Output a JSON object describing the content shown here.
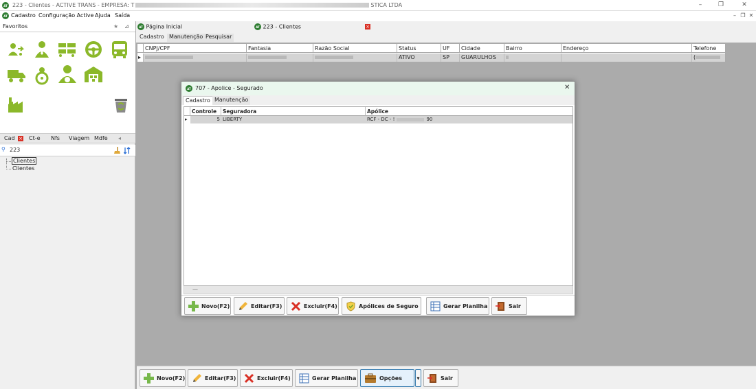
{
  "window": {
    "title_prefix": "223 - Clientes - ACTIVE TRANS - EMPRESA: T",
    "title_suffix": "STICA LTDA",
    "minimize": "–",
    "maximize": "❐",
    "close": "✕"
  },
  "logo_text": "AT",
  "menu": {
    "items": [
      "Cadastro",
      "Configuração Active",
      "Ajuda",
      "Saída"
    ],
    "mdi_min": "–",
    "mdi_restore": "❐",
    "mdi_close": "✕"
  },
  "favorites": {
    "title": "Favoritos",
    "star": "★",
    "pin": "⊿",
    "icons": [
      "user-route-icon",
      "driver-icon",
      "trucks-icon",
      "steering-wheel-icon",
      "bus-icon",
      "truck-icon",
      "driver-steering-icon",
      "driver-car-icon",
      "warehouse-icon",
      "factory-icon",
      "recycle-bin-icon"
    ]
  },
  "left_tabs": {
    "items": [
      "Cad",
      "Ct-e",
      "Nfs",
      "Viagem",
      "Mdfe"
    ],
    "close": "×",
    "scroll_left": "◂"
  },
  "search": {
    "value": "223",
    "icon": "🔍"
  },
  "tree": {
    "items": [
      "Clientes",
      "Clientes"
    ]
  },
  "doc_tabs": {
    "home": "Página Inicial",
    "clients": "223 - Clientes",
    "close": "×"
  },
  "sub_tabs": [
    "Cadastro",
    "Manutenção",
    "Pesquisar"
  ],
  "main_grid": {
    "columns": [
      "CNPJ/CPF",
      "Fantasia",
      "Razão Social",
      "Status",
      "UF",
      "Cidade",
      "Bairro",
      "Endereço",
      "Telefone"
    ],
    "row": {
      "status": "ATIVO",
      "uf": "SP",
      "cidade": "GUARULHOS",
      "telefone": "("
    }
  },
  "dialog": {
    "title": "707 - Apolice - Segurado",
    "close": "✕",
    "tabs": [
      "Cadastro",
      "Manutenção"
    ],
    "columns": [
      "Controle",
      "Seguradora",
      "Apólice"
    ],
    "row": {
      "controle": "5",
      "seguradora": "LIBERTY",
      "apolice_prefix": "RCF - DC - !",
      "apolice_suffix": "90"
    },
    "status_mark": "—",
    "buttons": [
      "Novo(F2)",
      "Editar(F3)",
      "Excluir(F4)",
      "Apólices de Seguro",
      "Gerar Planilha",
      "Sair"
    ]
  },
  "toolbar": {
    "buttons": [
      "Novo(F2)",
      "Editar(F3)",
      "Excluir(F4)",
      "Gerar Planilha",
      "Opções",
      "Sair"
    ],
    "dropdown": "▾"
  },
  "colors": {
    "accent_green": "#8bb82a",
    "dark_green": "#2f7d32",
    "red": "#d93025",
    "dialog_title_bg": "#eaf7ee",
    "selection_gray": "#d4d4d4"
  }
}
